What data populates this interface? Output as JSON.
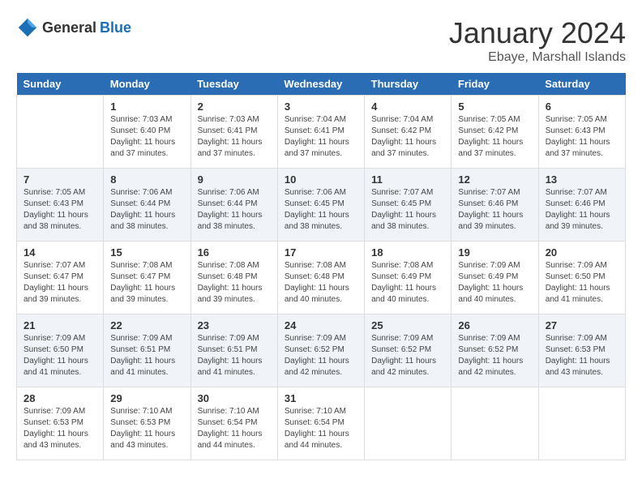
{
  "header": {
    "logo_general": "General",
    "logo_blue": "Blue",
    "month_title": "January 2024",
    "location": "Ebaye, Marshall Islands"
  },
  "weekdays": [
    "Sunday",
    "Monday",
    "Tuesday",
    "Wednesday",
    "Thursday",
    "Friday",
    "Saturday"
  ],
  "weeks": [
    [
      {
        "day": "",
        "text": ""
      },
      {
        "day": "1",
        "text": "Sunrise: 7:03 AM\nSunset: 6:40 PM\nDaylight: 11 hours\nand 37 minutes."
      },
      {
        "day": "2",
        "text": "Sunrise: 7:03 AM\nSunset: 6:41 PM\nDaylight: 11 hours\nand 37 minutes."
      },
      {
        "day": "3",
        "text": "Sunrise: 7:04 AM\nSunset: 6:41 PM\nDaylight: 11 hours\nand 37 minutes."
      },
      {
        "day": "4",
        "text": "Sunrise: 7:04 AM\nSunset: 6:42 PM\nDaylight: 11 hours\nand 37 minutes."
      },
      {
        "day": "5",
        "text": "Sunrise: 7:05 AM\nSunset: 6:42 PM\nDaylight: 11 hours\nand 37 minutes."
      },
      {
        "day": "6",
        "text": "Sunrise: 7:05 AM\nSunset: 6:43 PM\nDaylight: 11 hours\nand 37 minutes."
      }
    ],
    [
      {
        "day": "7",
        "text": "Sunrise: 7:05 AM\nSunset: 6:43 PM\nDaylight: 11 hours\nand 38 minutes."
      },
      {
        "day": "8",
        "text": "Sunrise: 7:06 AM\nSunset: 6:44 PM\nDaylight: 11 hours\nand 38 minutes."
      },
      {
        "day": "9",
        "text": "Sunrise: 7:06 AM\nSunset: 6:44 PM\nDaylight: 11 hours\nand 38 minutes."
      },
      {
        "day": "10",
        "text": "Sunrise: 7:06 AM\nSunset: 6:45 PM\nDaylight: 11 hours\nand 38 minutes."
      },
      {
        "day": "11",
        "text": "Sunrise: 7:07 AM\nSunset: 6:45 PM\nDaylight: 11 hours\nand 38 minutes."
      },
      {
        "day": "12",
        "text": "Sunrise: 7:07 AM\nSunset: 6:46 PM\nDaylight: 11 hours\nand 39 minutes."
      },
      {
        "day": "13",
        "text": "Sunrise: 7:07 AM\nSunset: 6:46 PM\nDaylight: 11 hours\nand 39 minutes."
      }
    ],
    [
      {
        "day": "14",
        "text": "Sunrise: 7:07 AM\nSunset: 6:47 PM\nDaylight: 11 hours\nand 39 minutes."
      },
      {
        "day": "15",
        "text": "Sunrise: 7:08 AM\nSunset: 6:47 PM\nDaylight: 11 hours\nand 39 minutes."
      },
      {
        "day": "16",
        "text": "Sunrise: 7:08 AM\nSunset: 6:48 PM\nDaylight: 11 hours\nand 39 minutes."
      },
      {
        "day": "17",
        "text": "Sunrise: 7:08 AM\nSunset: 6:48 PM\nDaylight: 11 hours\nand 40 minutes."
      },
      {
        "day": "18",
        "text": "Sunrise: 7:08 AM\nSunset: 6:49 PM\nDaylight: 11 hours\nand 40 minutes."
      },
      {
        "day": "19",
        "text": "Sunrise: 7:09 AM\nSunset: 6:49 PM\nDaylight: 11 hours\nand 40 minutes."
      },
      {
        "day": "20",
        "text": "Sunrise: 7:09 AM\nSunset: 6:50 PM\nDaylight: 11 hours\nand 41 minutes."
      }
    ],
    [
      {
        "day": "21",
        "text": "Sunrise: 7:09 AM\nSunset: 6:50 PM\nDaylight: 11 hours\nand 41 minutes."
      },
      {
        "day": "22",
        "text": "Sunrise: 7:09 AM\nSunset: 6:51 PM\nDaylight: 11 hours\nand 41 minutes."
      },
      {
        "day": "23",
        "text": "Sunrise: 7:09 AM\nSunset: 6:51 PM\nDaylight: 11 hours\nand 41 minutes."
      },
      {
        "day": "24",
        "text": "Sunrise: 7:09 AM\nSunset: 6:52 PM\nDaylight: 11 hours\nand 42 minutes."
      },
      {
        "day": "25",
        "text": "Sunrise: 7:09 AM\nSunset: 6:52 PM\nDaylight: 11 hours\nand 42 minutes."
      },
      {
        "day": "26",
        "text": "Sunrise: 7:09 AM\nSunset: 6:52 PM\nDaylight: 11 hours\nand 42 minutes."
      },
      {
        "day": "27",
        "text": "Sunrise: 7:09 AM\nSunset: 6:53 PM\nDaylight: 11 hours\nand 43 minutes."
      }
    ],
    [
      {
        "day": "28",
        "text": "Sunrise: 7:09 AM\nSunset: 6:53 PM\nDaylight: 11 hours\nand 43 minutes."
      },
      {
        "day": "29",
        "text": "Sunrise: 7:10 AM\nSunset: 6:53 PM\nDaylight: 11 hours\nand 43 minutes."
      },
      {
        "day": "30",
        "text": "Sunrise: 7:10 AM\nSunset: 6:54 PM\nDaylight: 11 hours\nand 44 minutes."
      },
      {
        "day": "31",
        "text": "Sunrise: 7:10 AM\nSunset: 6:54 PM\nDaylight: 11 hours\nand 44 minutes."
      },
      {
        "day": "",
        "text": ""
      },
      {
        "day": "",
        "text": ""
      },
      {
        "day": "",
        "text": ""
      }
    ]
  ]
}
